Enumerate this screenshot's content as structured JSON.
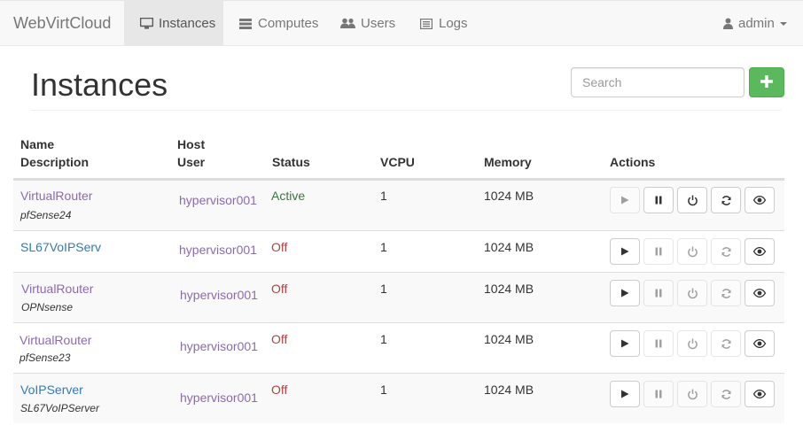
{
  "nav": {
    "brand": "WebVirtCloud",
    "items": [
      {
        "label": "Instances",
        "icon": "monitor-icon",
        "active": true
      },
      {
        "label": "Computes",
        "icon": "server-icon",
        "active": false
      },
      {
        "label": "Users",
        "icon": "users-icon",
        "active": false
      },
      {
        "label": "Logs",
        "icon": "list-icon",
        "active": false
      }
    ],
    "user": {
      "label": "admin",
      "icon": "user-icon"
    }
  },
  "page": {
    "title": "Instances",
    "search_placeholder": "Search",
    "add_icon": "plus-icon",
    "add_color": "#5cb85c"
  },
  "table": {
    "headers": {
      "name": "Name",
      "description": "Description",
      "host": "Host",
      "user": "User",
      "status": "Status",
      "vcpu": "VCPU",
      "memory": "Memory",
      "actions": "Actions"
    },
    "rows": [
      {
        "name": "VirtualRouter",
        "description": "pfSense24",
        "host": "hypervisor001",
        "status": "Active",
        "vcpu": "1",
        "memory": "1024 MB",
        "running": true
      },
      {
        "name": "SL67VoIPServ",
        "description": "",
        "host": "hypervisor001",
        "status": "Off",
        "vcpu": "1",
        "memory": "1024 MB",
        "running": false
      },
      {
        "name": "VirtualRouter",
        "description": "OPNsense",
        "host": "hypervisor001",
        "status": "Off",
        "vcpu": "1",
        "memory": "1024 MB",
        "running": false
      },
      {
        "name": "VirtualRouter",
        "description": "pfSense23",
        "host": "hypervisor001",
        "status": "Off",
        "vcpu": "1",
        "memory": "1024 MB",
        "running": false
      },
      {
        "name": "VoIPServer",
        "description": "SL67VoIPServer",
        "host": "hypervisor001",
        "status": "Off",
        "vcpu": "1",
        "memory": "1024 MB",
        "running": false
      }
    ],
    "action_icons": [
      "play-icon",
      "pause-icon",
      "power-icon",
      "refresh-icon",
      "eye-icon"
    ],
    "status_colors": {
      "Active": "#3c763d",
      "Off": "#a94442"
    }
  }
}
